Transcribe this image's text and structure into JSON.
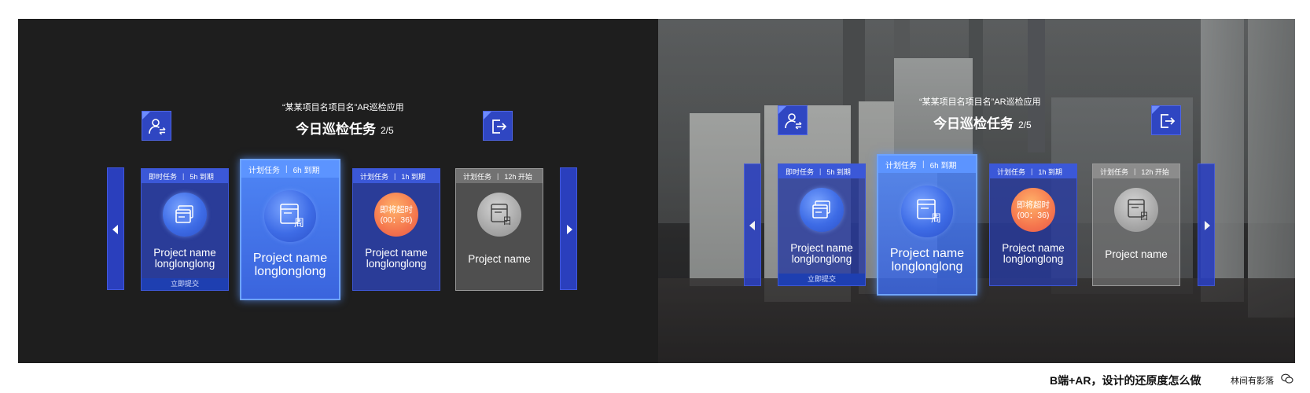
{
  "app": {
    "subtitle": "“某某项目名项目名”AR巡检应用",
    "title": "今日巡检任务",
    "progress": "2/5"
  },
  "icons": {
    "switch_user": "user-switch-icon",
    "exit": "logout-icon",
    "prev": "caret-left-icon",
    "next": "caret-right-icon"
  },
  "cards": [
    {
      "type": "即时任务",
      "deadline": "5h 到期",
      "line1": "Project name",
      "line2": "longlonglong",
      "action": "立即提交",
      "icon": "window-icon",
      "state": "normal"
    },
    {
      "type": "计划任务",
      "deadline": "6h 到期",
      "line1": "Project name",
      "line2": "longlonglong",
      "icon": "weekly-calendar-icon",
      "badge": "周",
      "state": "selected"
    },
    {
      "type": "计划任务",
      "deadline": "1h 到期",
      "line1": "Project name",
      "line2": "longlonglong",
      "warning_line1": "即将超时",
      "warning_line2": "(00：36)",
      "state": "warning"
    },
    {
      "type": "计划任务",
      "deadline": "12h 开始",
      "line1": "Project name",
      "icon": "daily-calendar-icon",
      "badge": "日",
      "state": "pending"
    }
  ],
  "footer": {
    "title": "B端+AR，设计的还原度怎么做",
    "author": "林间有影落",
    "icon": "wechat-icon"
  },
  "colors": {
    "accent": "#2f46c2",
    "selected": "#4f86f5",
    "warning": "#f5774e",
    "pending": "#9a9a9a"
  }
}
